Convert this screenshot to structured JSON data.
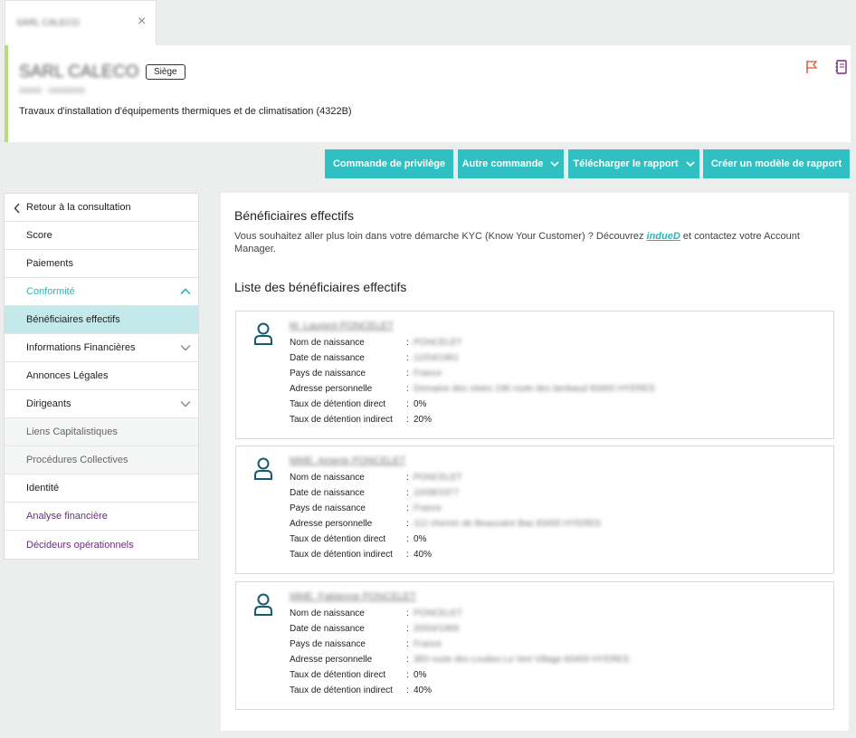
{
  "tab": {
    "label": "SARL CALECO"
  },
  "header": {
    "company_name": "SARL CALECO",
    "company_sub": "00000 · 00000000",
    "badge": "Siège",
    "activity": "Travaux d'installation d'équipements thermiques et de climatisation   (4322B)"
  },
  "actions": {
    "privilege": "Commande de privilège",
    "other": "Autre commande",
    "download": "Télécharger le rapport",
    "create_model": "Créer un modèle de rapport"
  },
  "sidebar": {
    "items": [
      {
        "label": "Retour à la consultation"
      },
      {
        "label": "Score"
      },
      {
        "label": "Paiements"
      },
      {
        "label": "Conformité"
      },
      {
        "label": "Bénéficiaires effectifs"
      },
      {
        "label": "Informations Financières"
      },
      {
        "label": "Annonces Légales"
      },
      {
        "label": "Dirigeants"
      },
      {
        "label": "Liens Capitalistiques"
      },
      {
        "label": "Procédures Collectives"
      },
      {
        "label": "Identité"
      },
      {
        "label": "Analyse financière"
      },
      {
        "label": "Décideurs opérationnels"
      }
    ]
  },
  "main": {
    "title": "Bénéficiaires effectifs",
    "desc_before": "Vous souhaitez aller plus loin dans votre démarche KYC (Know Your Customer) ? Découvrez ",
    "desc_link": "indueD",
    "desc_after": " et contactez votre Account Manager.",
    "list_title": "Liste des bénéficiaires effectifs",
    "labels": {
      "birth_name": "Nom de naissance",
      "birth_date": "Date de naissance",
      "birth_country": "Pays de naissance",
      "address": "Adresse personnelle",
      "direct": "Taux de détention direct",
      "indirect": "Taux de détention indirect"
    },
    "colon": ":",
    "beneficiaries": [
      {
        "name": "M. Laurent PONCELET",
        "birth_name": "PONCELET",
        "birth_date": "12/04/1961",
        "birth_country": "France",
        "address": "Domaine des vistes 196 route des lambaud 83400 HYERES",
        "direct": "0%",
        "indirect": "20%"
      },
      {
        "name": "MME. Amerie PONCELET",
        "birth_name": "PONCELET",
        "birth_date": "10/08/1977",
        "birth_country": "France",
        "address": "112 chemin de Beaucaire Bas 83400 HYERES",
        "direct": "0%",
        "indirect": "40%"
      },
      {
        "name": "MME. Fabienne PONCELET",
        "birth_name": "PONCELET",
        "birth_date": "20/04/1969",
        "birth_country": "France",
        "address": "383 route des Loubes Le Vert Village 83400 HYERES",
        "direct": "0%",
        "indirect": "40%"
      }
    ]
  }
}
